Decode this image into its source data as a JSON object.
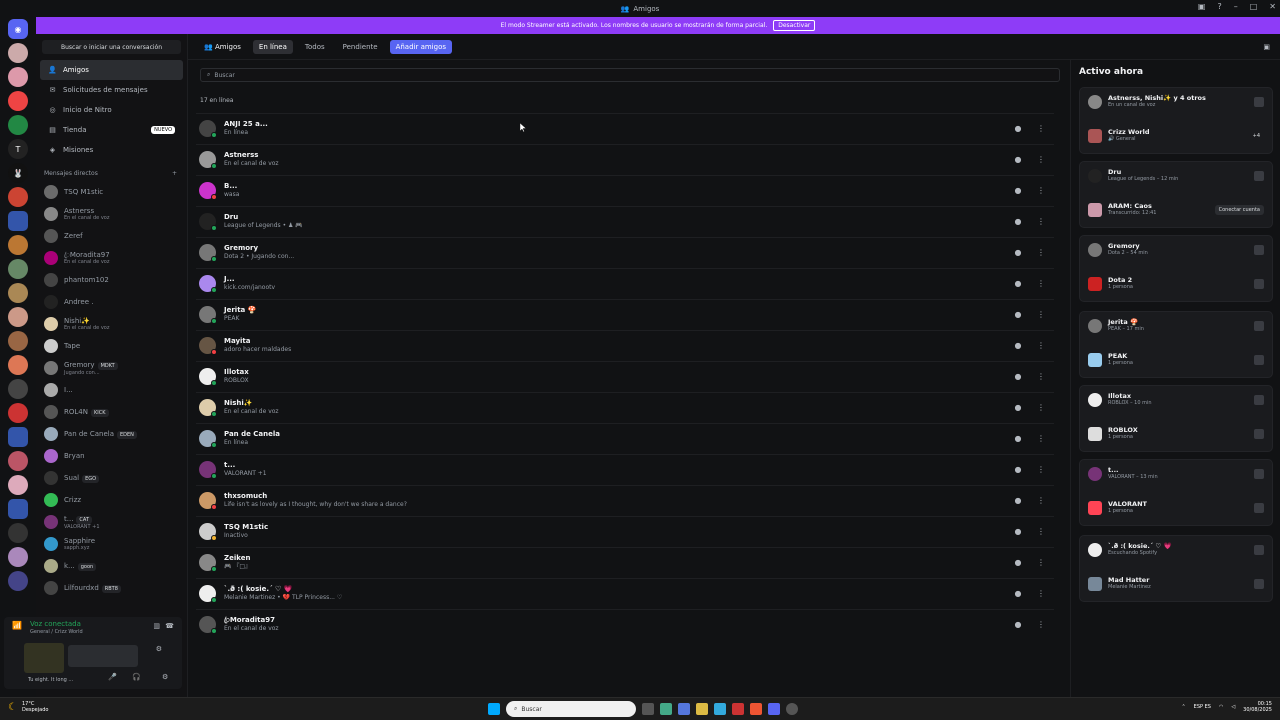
{
  "window": {
    "title": "Amigos"
  },
  "banner": {
    "text": "El modo Streamer está activado. Los nombres de usuario se mostrarán de forma parcial.",
    "button": "Desactivar"
  },
  "sidebar": {
    "search_label": "Buscar o iniciar una conversación",
    "nav": [
      {
        "label": "Amigos",
        "icon": "friends-icon"
      },
      {
        "label": "Solicitudes de mensajes",
        "icon": "mail-icon"
      },
      {
        "label": "Inicio de Nitro",
        "icon": "nitro-icon"
      },
      {
        "label": "Tienda",
        "icon": "shop-icon",
        "badge": "NUEVO"
      },
      {
        "label": "Misiones",
        "icon": "quest-icon"
      }
    ],
    "dm_header": "Mensajes directos",
    "dm_add": "+",
    "dms": [
      {
        "name": "TSQ M1stic",
        "status": "",
        "tag": "",
        "color": "#6b6b6b"
      },
      {
        "name": "Astnerss",
        "status": "En el canal de voz",
        "tag": "",
        "color": "#888"
      },
      {
        "name": "Zeref",
        "status": "",
        "tag": "",
        "color": "#555"
      },
      {
        "name": "ꦿMoradita97",
        "status": "En el canal de voz",
        "tag": "",
        "color": "#a07"
      },
      {
        "name": "phantom102",
        "status": "",
        "tag": "",
        "color": "#444"
      },
      {
        "name": "Andree .",
        "status": "",
        "tag": "",
        "color": "#222"
      },
      {
        "name": "Nishi✨",
        "status": "En el canal de voz",
        "tag": "",
        "color": "#dca"
      },
      {
        "name": "Tape",
        "status": "",
        "tag": "",
        "color": "#ccc"
      },
      {
        "name": "Gremory",
        "status": "Jugando con...",
        "tag": "MDKT",
        "color": "#777"
      },
      {
        "name": "I...",
        "status": "",
        "tag": "",
        "color": "#aaa"
      },
      {
        "name": "ROL4N",
        "status": "",
        "tag": "KICK",
        "color": "#555"
      },
      {
        "name": "Pan de Canela",
        "status": "",
        "tag": "EDEN",
        "color": "#9ab"
      },
      {
        "name": "Bryan",
        "status": "",
        "tag": "",
        "color": "#a6c"
      },
      {
        "name": "Sual",
        "status": "",
        "tag": "EGO",
        "color": "#333"
      },
      {
        "name": "Crizz",
        "status": "",
        "tag": "",
        "color": "#3b5"
      },
      {
        "name": "t...",
        "status": "VALORANT +1",
        "tag": "CAT",
        "color": "#737"
      },
      {
        "name": "Sapphire",
        "status": "sapph.xyz",
        "tag": "",
        "color": "#39c"
      },
      {
        "name": "k...",
        "status": "",
        "tag": "goon",
        "color": "#aa8"
      },
      {
        "name": "Lilfourdxd",
        "status": "",
        "tag": "RBT8",
        "color": "#444"
      }
    ],
    "voice": {
      "title": "Voz conectada",
      "sub": "General / Crizz World"
    },
    "user_status": "Tu eight. It long ..."
  },
  "topbar": {
    "friends_label": "Amigos",
    "tabs": [
      "En línea",
      "Todos",
      "Pendiente"
    ],
    "selected_tab": "En línea",
    "add_button": "Añadir amigos"
  },
  "main": {
    "search_placeholder": "Buscar",
    "online_count": "17 en línea",
    "friends": [
      {
        "name": "ANJI 25 a...",
        "status": "En línea",
        "color": "#444",
        "dot": "#23a55a"
      },
      {
        "name": "Astnerss",
        "status": "En el canal de voz",
        "color": "#999",
        "dot": "#23a55a"
      },
      {
        "name": "B...",
        "status": "wasa",
        "color": "#c3c",
        "dot": "#f23f43"
      },
      {
        "name": "Dru",
        "status": "League of Legends • ♟ 🎮",
        "color": "#222",
        "dot": "#23a55a"
      },
      {
        "name": "Gremory",
        "status": "Dota 2 • Jugando con...",
        "color": "#777",
        "dot": "#23a55a"
      },
      {
        "name": "J...",
        "status": "kick.com/janootv",
        "color": "#a8e",
        "dot": "#23a55a"
      },
      {
        "name": "Jerita 🍄",
        "status": "PEAK",
        "color": "#777",
        "dot": "#23a55a"
      },
      {
        "name": "Mayita",
        "status": "adoro hacer maldades",
        "color": "#654",
        "dot": "#f23f43"
      },
      {
        "name": "Illotax",
        "status": "ROBLOX",
        "color": "#eee",
        "dot": "#23a55a"
      },
      {
        "name": "Nishi✨",
        "status": "En el canal de voz",
        "color": "#dca",
        "dot": "#23a55a"
      },
      {
        "name": "Pan de Canela",
        "status": "En línea",
        "color": "#9ab",
        "dot": "#23a55a"
      },
      {
        "name": "t...",
        "status": "VALORANT +1",
        "color": "#737",
        "dot": "#23a55a"
      },
      {
        "name": "thxsomuch",
        "status": "Life isn't as lovely as I thought, why don't we share a dance?",
        "color": "#c96",
        "dot": "#f23f43"
      },
      {
        "name": "TSQ M1stic",
        "status": "Inactivo",
        "color": "#ccc",
        "dot": "#f0b232"
      },
      {
        "name": "Zeiken",
        "status": "🎮 『□』",
        "color": "#888",
        "dot": "#23a55a"
      },
      {
        "name": "`.ð̷ :( kosie.´ ♡ 💗",
        "status": "Melanie Martinez • 💔 TLP Princess... ♡",
        "color": "#eee",
        "dot": "#23a55a"
      },
      {
        "name": "ꦿMoradita97",
        "status": "En el canal de voz",
        "color": "#555",
        "dot": "#23a55a"
      }
    ]
  },
  "active_now": {
    "title": "Activo ahora",
    "cards": [
      {
        "rows": [
          {
            "name": "Astnerss, Nishi✨ y 4 otros",
            "sub": "En un canal de voz",
            "color": "#888"
          },
          {
            "name": "Crizz World",
            "sub": "🔊 General",
            "color": "#a55",
            "extra": "+4"
          }
        ]
      },
      {
        "rows": [
          {
            "name": "Dru",
            "sub": "League of Legends – 12 min",
            "color": "#222"
          },
          {
            "name": "ARAM: Caos",
            "sub": "Transcurrido: 12:41",
            "color": "#c9a",
            "button": "Conectar cuenta"
          }
        ]
      },
      {
        "rows": [
          {
            "name": "Gremory",
            "sub": "Dota 2 – 54 min",
            "color": "#777"
          },
          {
            "name": "Dota 2",
            "sub": "1 persona",
            "color": "#c22"
          }
        ]
      },
      {
        "rows": [
          {
            "name": "Jerita 🍄",
            "sub": "PEAK – 17 min",
            "color": "#777"
          },
          {
            "name": "PEAK",
            "sub": "1 persona",
            "color": "#9ce"
          }
        ]
      },
      {
        "rows": [
          {
            "name": "Illotax",
            "sub": "ROBLOX – 10 min",
            "color": "#eee"
          },
          {
            "name": "ROBLOX",
            "sub": "1 persona",
            "color": "#ddd"
          }
        ]
      },
      {
        "rows": [
          {
            "name": "t...",
            "sub": "VALORANT – 13 min",
            "color": "#737"
          },
          {
            "name": "VALORANT",
            "sub": "1 persona",
            "color": "#f45"
          }
        ]
      },
      {
        "rows": [
          {
            "name": "`.ð̷ :( kosie.´ ♡ 💗",
            "sub": "Escuchando Spotify",
            "color": "#eee"
          },
          {
            "name": "Mad Hatter",
            "sub": "Melanie Martinez",
            "color": "#789"
          }
        ]
      }
    ]
  },
  "taskbar": {
    "temp": "17°C",
    "weather": "Despejado",
    "search": "Buscar",
    "lang": "ESP ES",
    "time": "00:15",
    "date": "30/08/2025"
  },
  "colors": {
    "accent": "#5865f2",
    "banner": "#8e3cf7",
    "online": "#23a55a",
    "dnd": "#f23f43",
    "idle": "#f0b232"
  }
}
